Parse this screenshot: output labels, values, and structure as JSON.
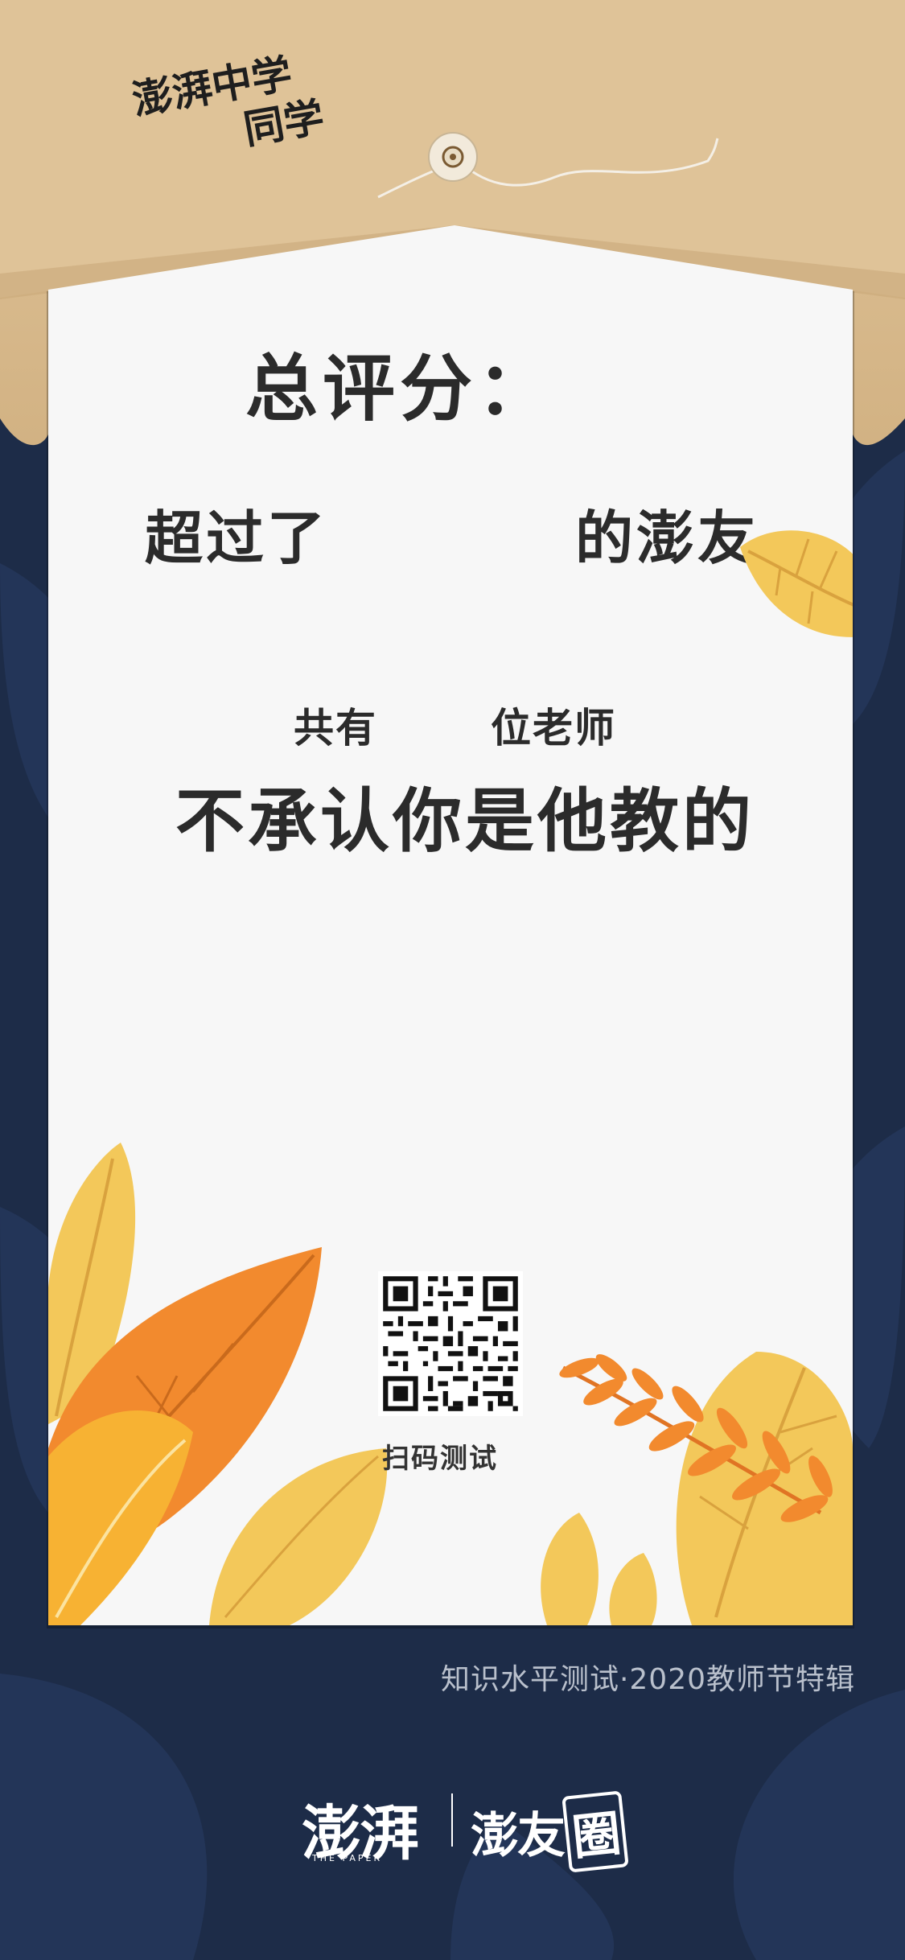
{
  "envelope": {
    "greeting_line1": "澎湃中学",
    "greeting_line2": "同学"
  },
  "result": {
    "score_label": "总评分：",
    "beyond_prefix": "超过了",
    "beyond_suffix": "的澎友",
    "total_prefix": "共有",
    "total_suffix": "位老师",
    "deny_text": "不承认你是他教的"
  },
  "qr": {
    "caption": "扫码测试"
  },
  "footer": {
    "caption": "知识水平测试·2020教师节特辑"
  },
  "brand": {
    "left_logo": "澎湃",
    "left_sub": "THE PAPER",
    "right_logo_a": "澎友",
    "right_logo_b": "圈"
  },
  "colors": {
    "background": "#1d2c48",
    "envelope": "#dcc096",
    "paper": "#f7f7f7",
    "leaf_yellow": "#f3c85a",
    "leaf_orange": "#f28a2e"
  }
}
